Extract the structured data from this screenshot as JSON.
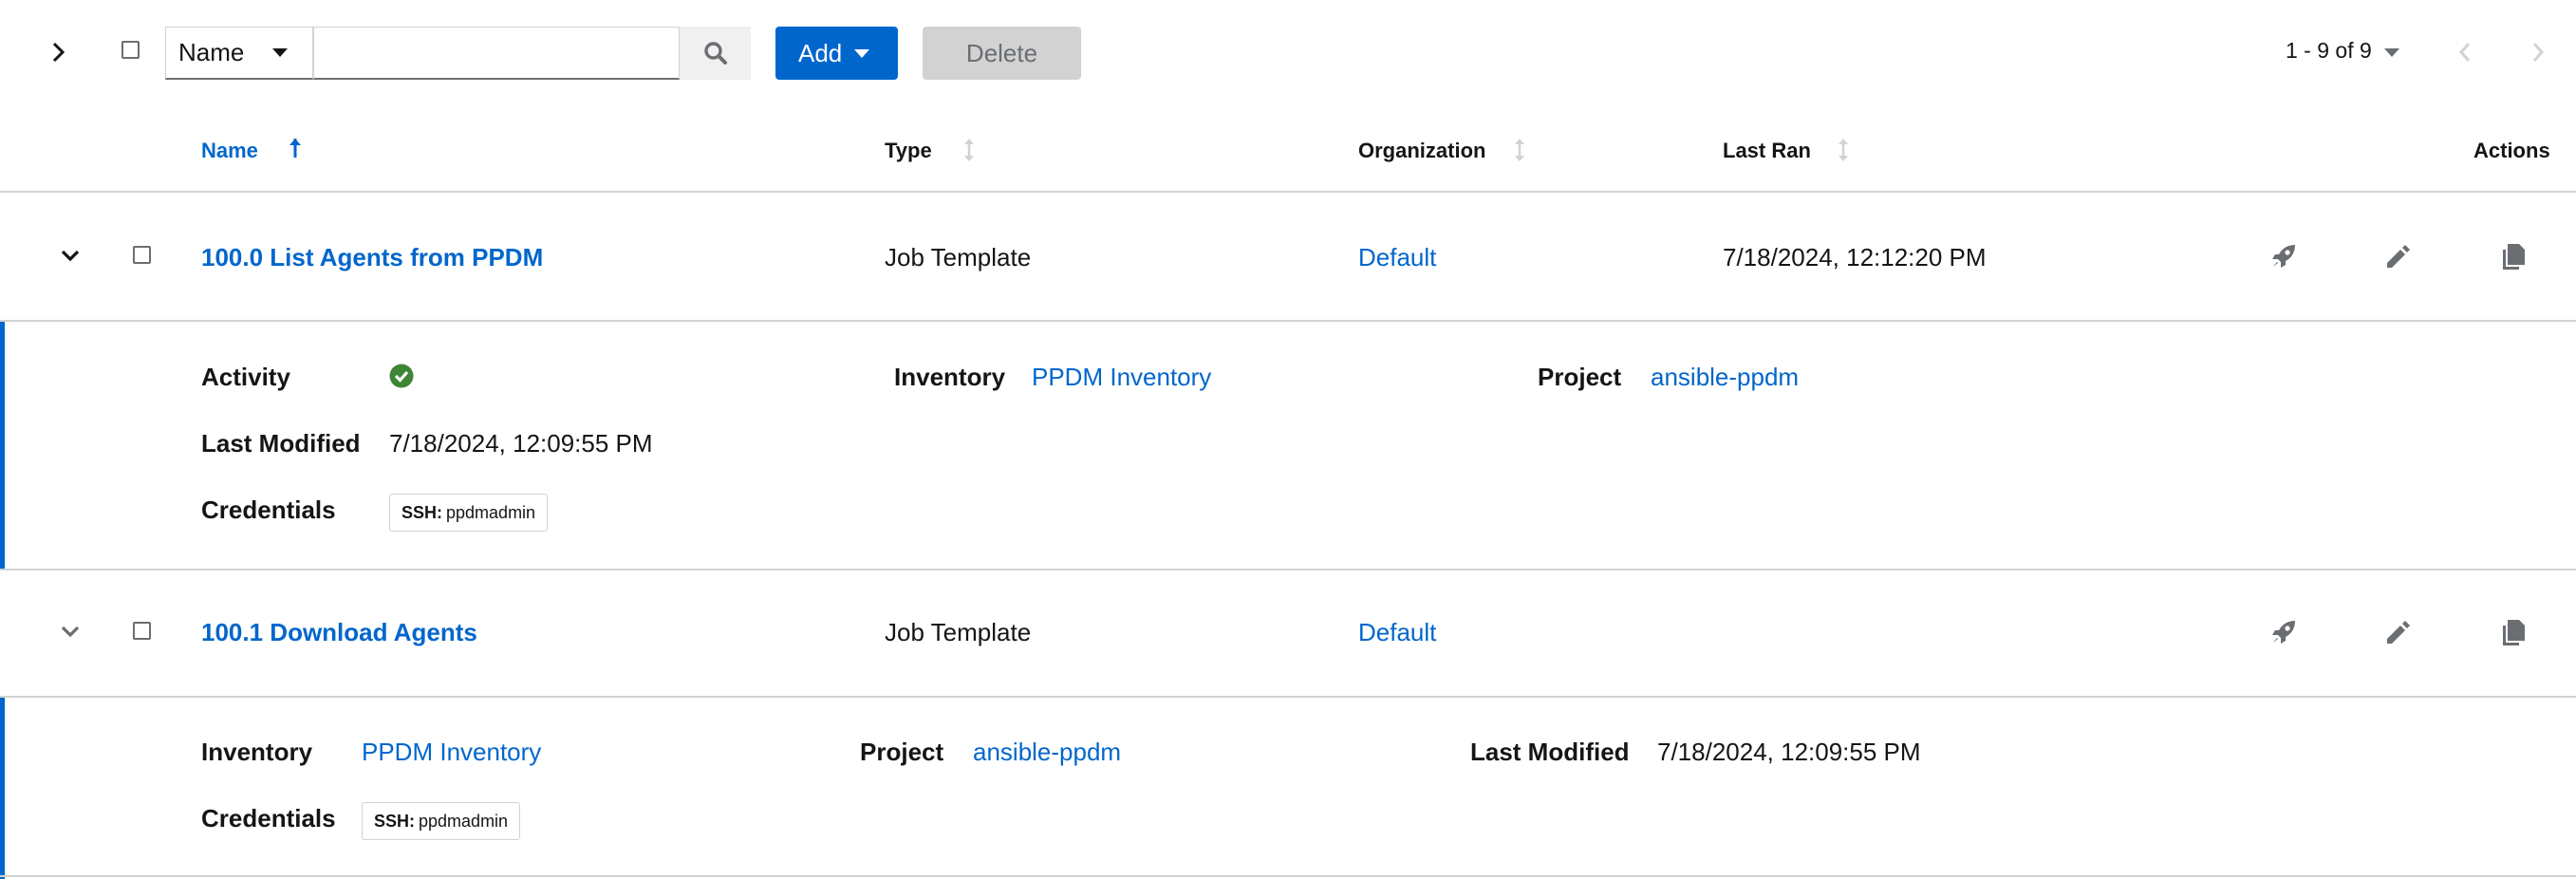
{
  "toolbar": {
    "filter_select": "Name",
    "search_placeholder": "",
    "add_label": "Add",
    "delete_label": "Delete",
    "pagination": "1 - 9 of 9"
  },
  "table": {
    "headers": {
      "name": "Name",
      "type": "Type",
      "organization": "Organization",
      "last_ran": "Last Ran",
      "actions": "Actions"
    },
    "rows": [
      {
        "name": "100.0 List Agents from PPDM",
        "type": "Job Template",
        "organization": "Default",
        "last_ran": "7/18/2024, 12:12:20 PM",
        "details": {
          "activity_label": "Activity",
          "activity_status": "success",
          "inventory_label": "Inventory",
          "inventory": "PPDM Inventory",
          "project_label": "Project",
          "project": "ansible-ppdm",
          "last_modified_label": "Last Modified",
          "last_modified": "7/18/2024, 12:09:55 PM",
          "credentials_label": "Credentials",
          "credential_kind": "SSH:",
          "credential_name": "ppdmadmin"
        }
      },
      {
        "name": "100.1 Download Agents",
        "type": "Job Template",
        "organization": "Default",
        "last_ran": "",
        "details": {
          "inventory_label": "Inventory",
          "inventory": "PPDM Inventory",
          "project_label": "Project",
          "project": "ansible-ppdm",
          "last_modified_label": "Last Modified",
          "last_modified": "7/18/2024, 12:09:55 PM",
          "credentials_label": "Credentials",
          "credential_kind": "SSH:",
          "credential_name": "ppdmadmin"
        }
      }
    ]
  },
  "colors": {
    "link": "#0066cc",
    "success": "#3e8635",
    "icon": "#6a6e73",
    "border": "#d2d2d2"
  },
  "icons": [
    "chevron-right-icon",
    "search-icon",
    "sort-up-icon",
    "sort-icon",
    "chevron-down-icon",
    "rocket-icon",
    "pencil-icon",
    "copy-icon",
    "check-circle-icon",
    "chevron-left-icon"
  ]
}
